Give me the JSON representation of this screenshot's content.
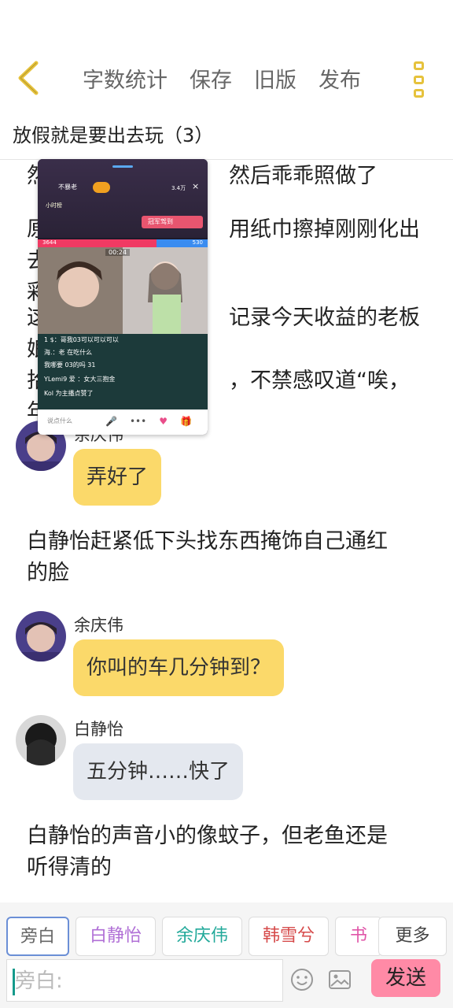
{
  "header": {
    "menu": [
      "字数统计",
      "保存",
      "旧版",
      "发布"
    ],
    "title": "放假就是要出去玩（3）"
  },
  "story": {
    "narr1": "然后乖乖照做了",
    "narr2_line1": "用纸巾擦掉刚刚化出去的唇",
    "narr2_line2": "彩",
    "narr3_line1": "记录今天收益的老板娘",
    "narr3_line2": "，不禁感叹道“唉，",
    "narr3_line3": "年",
    "msg1": {
      "speaker": "余庆伟",
      "text": "弄好了"
    },
    "narr4_line1": "白静怡赶紧低下头找东西掩饰自己通红",
    "narr4_line2": "的脸",
    "msg2": {
      "speaker": "余庆伟",
      "text": "你叫的车几分钟到？"
    },
    "msg3": {
      "speaker": "白静怡",
      "text": "五分钟……快了"
    },
    "narr5_line1": "白静怡的声音小的像蚊子，但老鱼还是",
    "narr5_line2": "听得清的",
    "narr1_left": "然",
    "narr2_left": "原",
    "narr2b_left": "彩",
    "narr3_left": "这",
    "narr3b_left": "拾",
    "narr3c_left": "年"
  },
  "live": {
    "host_name": "不暴老",
    "viewer_count": "3.4万",
    "close": "×",
    "small_label": "小时榜",
    "badge": "冠军驾到",
    "score_left": "3644",
    "score_right": "530",
    "timer": "00:24",
    "chat": [
      "1 $：哥我03可以可以可以",
      "海.：老 在吃什么",
      "我哪要 03的吗 31",
      "YLemi9 爱 ：女大三抱金",
      "Kol 为主播点赞了"
    ],
    "input_placeholder": "说点什么"
  },
  "toolbar": {
    "roles": [
      {
        "label": "旁白",
        "color": "#666666"
      },
      {
        "label": "白静怡",
        "color": "#b06fd6"
      },
      {
        "label": "余庆伟",
        "color": "#22a99a"
      },
      {
        "label": "韩雪兮",
        "color": "#d64a4a"
      },
      {
        "label": "书咔",
        "color": "#e056a8"
      }
    ],
    "more": "更多",
    "input_placeholder": "旁白:",
    "send": "发送"
  }
}
